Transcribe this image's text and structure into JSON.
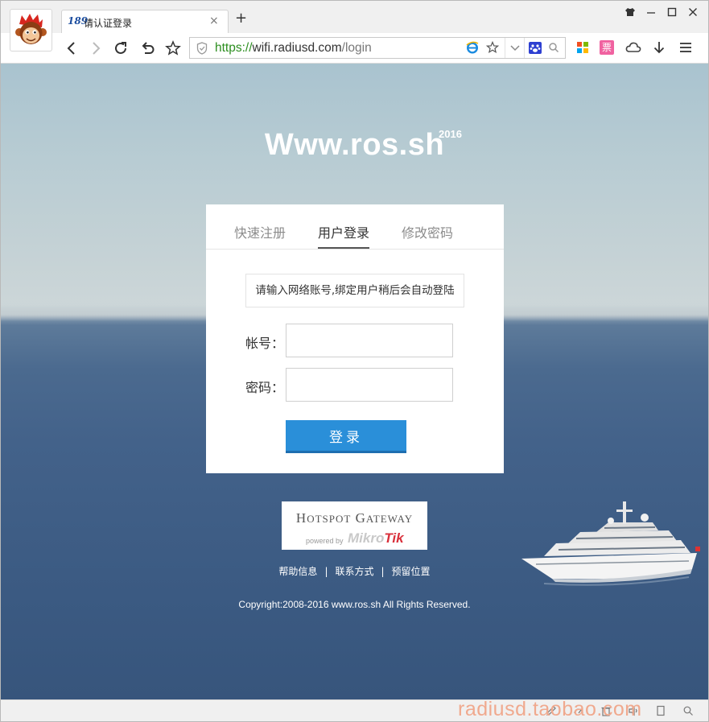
{
  "browser": {
    "tab_title": "请认证登录",
    "tab_favicon": "189",
    "tab_close": "×",
    "new_tab": "+",
    "url_scheme": "https://",
    "url_host": "wifi.radiusd.com",
    "url_path": "/login",
    "icons": [
      "shirt-icon",
      "minimize-icon",
      "maximize-icon",
      "close-icon",
      "back-icon",
      "forward-icon",
      "reload-icon",
      "undo-icon",
      "star-icon",
      "shield-icon",
      "ie-icon",
      "paw-icon",
      "search-icon",
      "apps-icon",
      "ticket-icon",
      "cloud-icon",
      "download-icon",
      "menu-icon"
    ],
    "ticket_label": "票"
  },
  "page": {
    "site_title": "Www.ros.sh",
    "site_year": "2016",
    "tabs": [
      {
        "label": "快速注册"
      },
      {
        "label": "用户登录"
      },
      {
        "label": "修改密码"
      }
    ],
    "active_tab": "用户登录",
    "notice": "请输入网络账号,绑定用户稍后会自动登陆",
    "account_label": "帐号：",
    "password_label": "密码：",
    "account_value": "",
    "password_value": "",
    "login_button": "登录",
    "hotspot": {
      "title_h": "H",
      "title_rest": "OTSPOT",
      "title_g": "G",
      "title_rest2": "ATEWAY",
      "powered": "powered by",
      "brand_a": "Mikro",
      "brand_b": "Tik"
    },
    "footer_links": [
      "帮助信息",
      "联系方式",
      "预留位置"
    ],
    "footer_sep": "|",
    "copyright": "Copyright:2008-2016 www.ros.sh All Rights Reserved."
  },
  "watermark": "radiusd.taobao.com",
  "colors": {
    "button": "#2a8fd9",
    "url_scheme": "#2c8e1f",
    "brand_red": "#d9303b",
    "sea": "#3f5e86",
    "sky": "#b8ccd3"
  }
}
